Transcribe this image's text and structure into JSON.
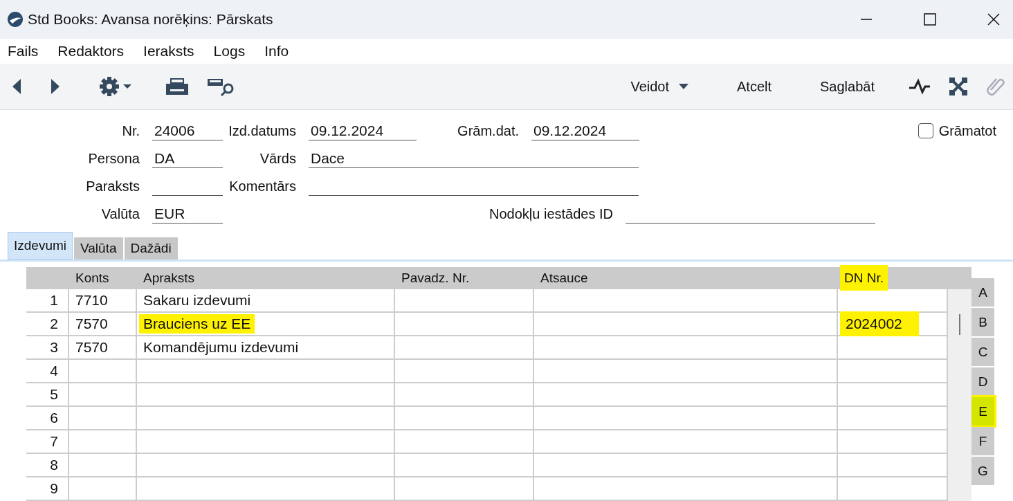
{
  "window": {
    "title": "Std Books: Avansa norēķins: Pārskats"
  },
  "menu": [
    "Fails",
    "Redaktors",
    "Ieraksts",
    "Logs",
    "Info"
  ],
  "toolbar": {
    "buttons": [
      {
        "label": "Veidot",
        "kind": "dropdown"
      },
      {
        "label": "Atcelt",
        "kind": "plain"
      },
      {
        "label": "Saglabāt",
        "kind": "plain"
      }
    ]
  },
  "form": {
    "nr": {
      "label": "Nr.",
      "value": "24006"
    },
    "izd_datums": {
      "label": "Izd.datums",
      "value": "09.12.2024"
    },
    "gram_dat": {
      "label": "Grām.dat.",
      "value": "09.12.2024"
    },
    "gramatot": {
      "label": "Grāmatot",
      "checked": false
    },
    "persona": {
      "label": "Persona",
      "value": "DA"
    },
    "vards": {
      "label": "Vārds",
      "value": "Dace"
    },
    "paraksts": {
      "label": "Paraksts"
    },
    "komentars": {
      "label": "Komentārs"
    },
    "valuta": {
      "label": "Valūta",
      "value": "EUR"
    },
    "nodoklu_id": {
      "label": "Nodokļu iestādes ID"
    }
  },
  "tabs": [
    {
      "label": "Izdevumi",
      "selected": true
    },
    {
      "label": "Valūta",
      "selected": false
    },
    {
      "label": "Dažādi",
      "selected": false
    }
  ],
  "table": {
    "columns": [
      {
        "label": "Konts",
        "highlighted": false
      },
      {
        "label": "Apraksts",
        "highlighted": false
      },
      {
        "label": "Pavadz. Nr.",
        "highlighted": false
      },
      {
        "label": "Atsauce",
        "highlighted": false
      },
      {
        "label": "DN Nr.",
        "highlighted": true
      }
    ],
    "rows": [
      {
        "num": "1",
        "konts": "7710",
        "apraksts": {
          "text": "Sakaru izdevumi",
          "highlighted": false
        }
      },
      {
        "num": "2",
        "konts": "7570",
        "apraksts": {
          "text": "Brauciens uz EE",
          "highlighted": true
        },
        "dn": {
          "text": "2024002",
          "highlighted": true
        }
      },
      {
        "num": "3",
        "konts": "7570",
        "apraksts": {
          "text": "Komandējumu izdevumi",
          "highlighted": false
        }
      },
      {
        "num": "4"
      },
      {
        "num": "5"
      },
      {
        "num": "6"
      },
      {
        "num": "7"
      },
      {
        "num": "8"
      },
      {
        "num": "9"
      }
    ]
  },
  "flaps": [
    {
      "label": "A",
      "selected": false
    },
    {
      "label": "B",
      "selected": false
    },
    {
      "label": "C",
      "selected": false
    },
    {
      "label": "D",
      "selected": false
    },
    {
      "label": "E",
      "selected": true
    },
    {
      "label": "F",
      "selected": false
    },
    {
      "label": "G",
      "selected": false
    }
  ]
}
